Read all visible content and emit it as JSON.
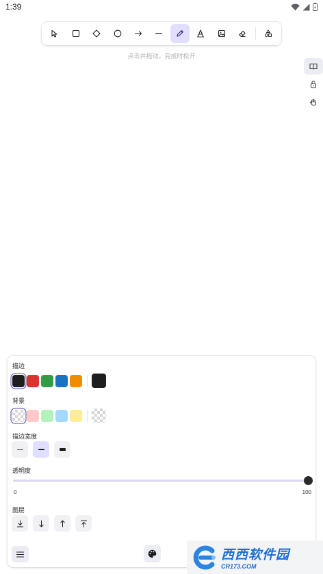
{
  "status_bar": {
    "time": "1:39"
  },
  "toolbar": {
    "tools": [
      {
        "id": "select",
        "icon": "cursor-icon",
        "active": false
      },
      {
        "id": "rectangle",
        "icon": "rectangle-icon",
        "active": false
      },
      {
        "id": "diamond",
        "icon": "diamond-icon",
        "active": false
      },
      {
        "id": "ellipse",
        "icon": "circle-icon",
        "active": false
      },
      {
        "id": "arrow",
        "icon": "arrow-right-icon",
        "active": false
      },
      {
        "id": "line",
        "icon": "line-icon",
        "active": false
      },
      {
        "id": "draw",
        "icon": "pencil-icon",
        "active": true
      },
      {
        "id": "text",
        "icon": "text-icon",
        "active": false
      },
      {
        "id": "image",
        "icon": "image-icon",
        "active": false
      },
      {
        "id": "eraser",
        "icon": "eraser-icon",
        "active": false
      },
      {
        "id": "library",
        "icon": "shapes-library-icon",
        "active": false
      }
    ]
  },
  "hint": "点击并拖动，完成时松开",
  "side_tools": [
    {
      "icon": "book-icon"
    },
    {
      "icon": "unlock-icon"
    },
    {
      "icon": "hand-icon"
    }
  ],
  "panel": {
    "stroke_label": "描边",
    "stroke_colors": [
      "#1e1e1e",
      "#e03131",
      "#2f9e44",
      "#1971c2",
      "#f08c00"
    ],
    "stroke_selected": "#1e1e1e",
    "background_label": "背景",
    "background_colors": [
      "transparent",
      "#ffc9c9",
      "#b2f2bb",
      "#a5d8ff",
      "#ffec99"
    ],
    "background_selected": "transparent",
    "stroke_width_label": "描边宽度",
    "stroke_widths": [
      {
        "id": "thin",
        "active": false
      },
      {
        "id": "bold",
        "active": true
      },
      {
        "id": "extra-bold",
        "active": false
      }
    ],
    "opacity_label": "透明度",
    "opacity": {
      "min": "0",
      "max": "100",
      "value": 100
    },
    "layers_label": "图层",
    "layer_actions": [
      {
        "icon": "send-to-back-icon"
      },
      {
        "icon": "send-backward-icon"
      },
      {
        "icon": "bring-forward-icon"
      },
      {
        "icon": "bring-to-front-icon"
      }
    ]
  },
  "watermark": {
    "title": "西西软件园",
    "url": "CR173.COM"
  },
  "colors": {
    "accent": "#e0dfff",
    "accent_dark": "#4a47b1"
  }
}
